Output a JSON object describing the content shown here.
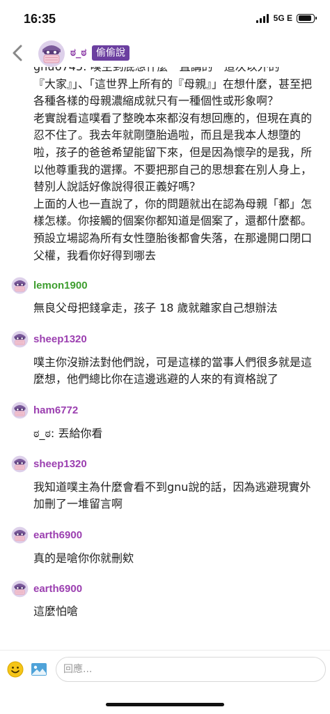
{
  "status_bar": {
    "time": "16:35",
    "network": "5G E",
    "battery_level": 0.9
  },
  "header": {
    "name": "ಠ_ಠ",
    "board": "偷偷說",
    "back_icon": "chevron-left-icon",
    "avatar_icon": "masked-face-avatar-icon"
  },
  "op_text": {
    "lines": [
      "gnu6745: 噗主到底想什麼一直講的一這次以外的",
      "『大家』」、「這世界上所有的『母親』」在想什麼，甚至把各種各樣的母親濃縮成就只有一種個性或形象啊？",
      "老實說看這噗看了整晚本來都沒有想回應的，但現在真的忍不住了。我去年就剛墮胎過啦，而且是我本人想墮的啦，孩子的爸爸希望能留下來，但是因為懷孕的是我，所以他尊重我的選擇。不要把那自己的思想套在別人身上，替別人說話好像說得很正義好嗎？",
      "上面的人也一直說了，你的問題就出在認為母親「都」怎樣怎樣。你接觸的個案你都知道是個案了，還都什麼都。",
      "預設立場認為所有女性墮胎後都會失落，在那邊開口閉口父權，我看你好得到哪去"
    ]
  },
  "responses": [
    {
      "user": "lemon1900",
      "color": "#3e9e2f",
      "text": "無良父母把錢拿走，孩子 18 歲就離家自己想辦法"
    },
    {
      "user": "sheep1320",
      "color": "#9b3fb0",
      "text": "噗主你沒辦法對他們說，可是這樣的當事人們很多就是這麼想，他們總比你在這邊逃避的人來的有資格說了"
    },
    {
      "user": "ham6772",
      "color": "#9b3fb0",
      "text": "ಠ_ಠ: 丟給你看"
    },
    {
      "user": "sheep1320",
      "color": "#9b3fb0",
      "text": "我知道噗主為什麼會看不到gnu說的話，因為逃避現實外加刪了一堆留言啊"
    },
    {
      "user": "earth6900",
      "color": "#9b3fb0",
      "text": "真的是嗆你你就刪欸"
    },
    {
      "user": "earth6900",
      "color": "#9b3fb0",
      "text": "這麼怕嗆"
    }
  ],
  "input_bar": {
    "placeholder": "回應...",
    "emoji_icon": "emoji-smile-icon",
    "image_icon": "image-upload-icon"
  },
  "colors": {
    "accent_purple": "#6b3fa0",
    "username_purple": "#9b3fb0",
    "username_green": "#3e9e2f"
  }
}
